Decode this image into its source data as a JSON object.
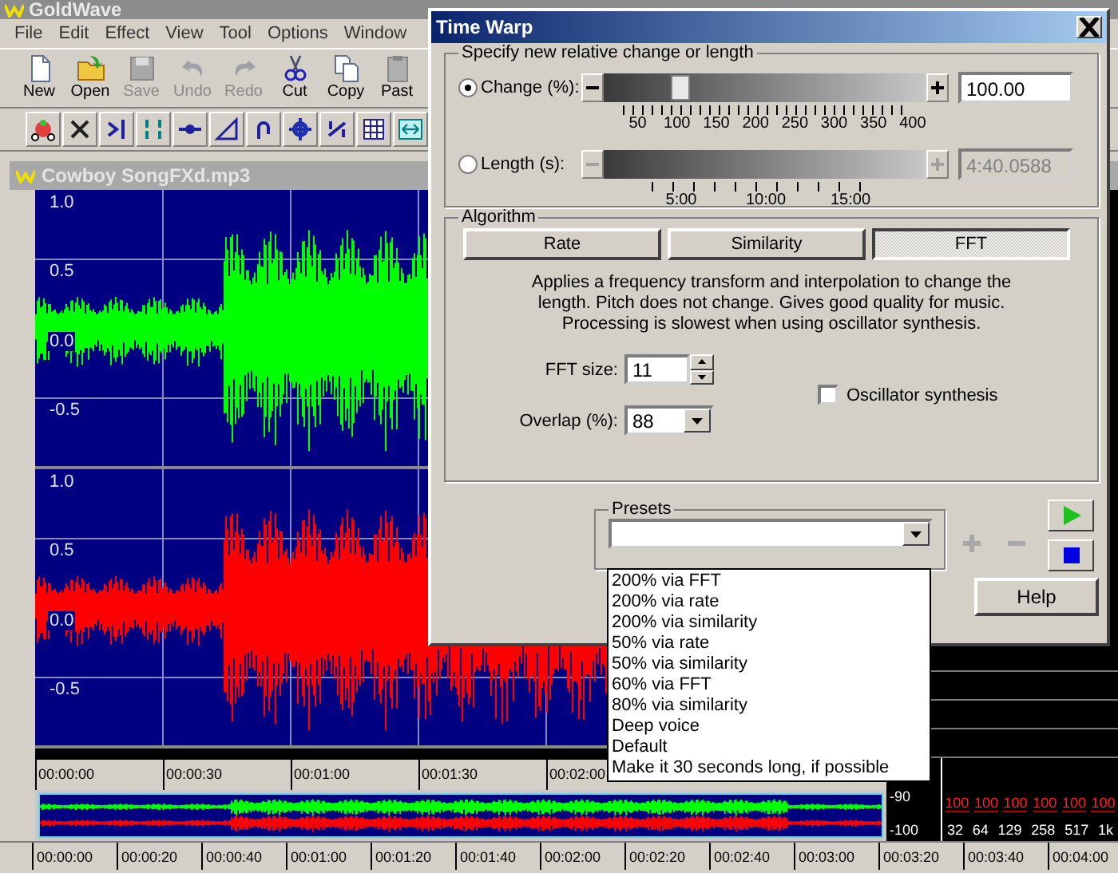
{
  "app": {
    "title": "GoldWave",
    "menu": [
      "File",
      "Edit",
      "Effect",
      "View",
      "Tool",
      "Options",
      "Window"
    ],
    "toolbar": [
      {
        "label": "New",
        "disabled": false
      },
      {
        "label": "Open",
        "disabled": false
      },
      {
        "label": "Save",
        "disabled": true
      },
      {
        "label": "Undo",
        "disabled": true
      },
      {
        "label": "Redo",
        "disabled": true
      },
      {
        "label": "Cut",
        "disabled": false
      },
      {
        "label": "Copy",
        "disabled": false
      },
      {
        "label": "Past",
        "disabled": false
      }
    ]
  },
  "sound_window": {
    "title": "Cowboy SongFXd.mp3",
    "channels": [
      {
        "color": "#00ff00",
        "axis": [
          "1.0",
          "0.5",
          "0.0",
          "-0.5"
        ]
      },
      {
        "color": "#ff0000",
        "axis": [
          "1.0",
          "0.5",
          "0.0",
          "-0.5"
        ]
      }
    ],
    "timeline": [
      "00:00:00",
      "00:00:30",
      "00:01:00",
      "00:01:30",
      "00:02:00"
    ],
    "overview_timeline": [
      "00:00:00",
      "00:00:20",
      "00:00:40",
      "00:01:00",
      "00:01:20",
      "00:01:40",
      "00:02:00",
      "00:02:20",
      "00:02:40",
      "00:03:00",
      "00:03:20",
      "00:03:40",
      "00:04:00"
    ]
  },
  "meter": {
    "scale": [
      "-90",
      "-100"
    ],
    "peaks": [
      "100",
      "100",
      "100",
      "100",
      "100",
      "100"
    ],
    "bands": [
      "32",
      "64",
      "129",
      "258",
      "517",
      "1k"
    ]
  },
  "dialog": {
    "title": "Time Warp",
    "specify": {
      "legend": "Specify new relative change or length",
      "rows": [
        {
          "label": "Change (%):",
          "selected": true,
          "disabled": false,
          "level": 0.22,
          "ticks": [
            "50",
            "100",
            "150",
            "200",
            "250",
            "300",
            "350",
            "400"
          ],
          "value": "100.00"
        },
        {
          "label": "Length (s):",
          "selected": false,
          "disabled": true,
          "ticks": [
            "5:00",
            "10:00",
            "15:00"
          ],
          "value": "4:40.0588"
        }
      ]
    },
    "algorithm": {
      "legend": "Algorithm",
      "methods": [
        {
          "label": "Rate",
          "selected": false
        },
        {
          "label": "Similarity",
          "selected": false
        },
        {
          "label": "FFT",
          "selected": true
        }
      ],
      "description": "Applies a frequency transform and interpolation to change the length.  Pitch does not change.  Gives good quality for music. Processing is slowest when using oscillator synthesis.",
      "fft_size": {
        "label": "FFT size:",
        "value": "11"
      },
      "overlap": {
        "label": "Overlap (%):",
        "value": "88"
      },
      "oscillator": {
        "label": "Oscillator synthesis",
        "checked": false
      }
    },
    "presets": {
      "legend": "Presets",
      "expanded": true,
      "actions_disabled": true,
      "options": [
        "200% via FFT",
        "200% via rate",
        "200% via similarity",
        "50% via rate",
        "50% via similarity",
        "60% via FFT",
        "80% via similarity",
        "Deep voice",
        "Default",
        "Make it 30 seconds long, if possible"
      ]
    },
    "buttons": [
      "Help"
    ]
  }
}
